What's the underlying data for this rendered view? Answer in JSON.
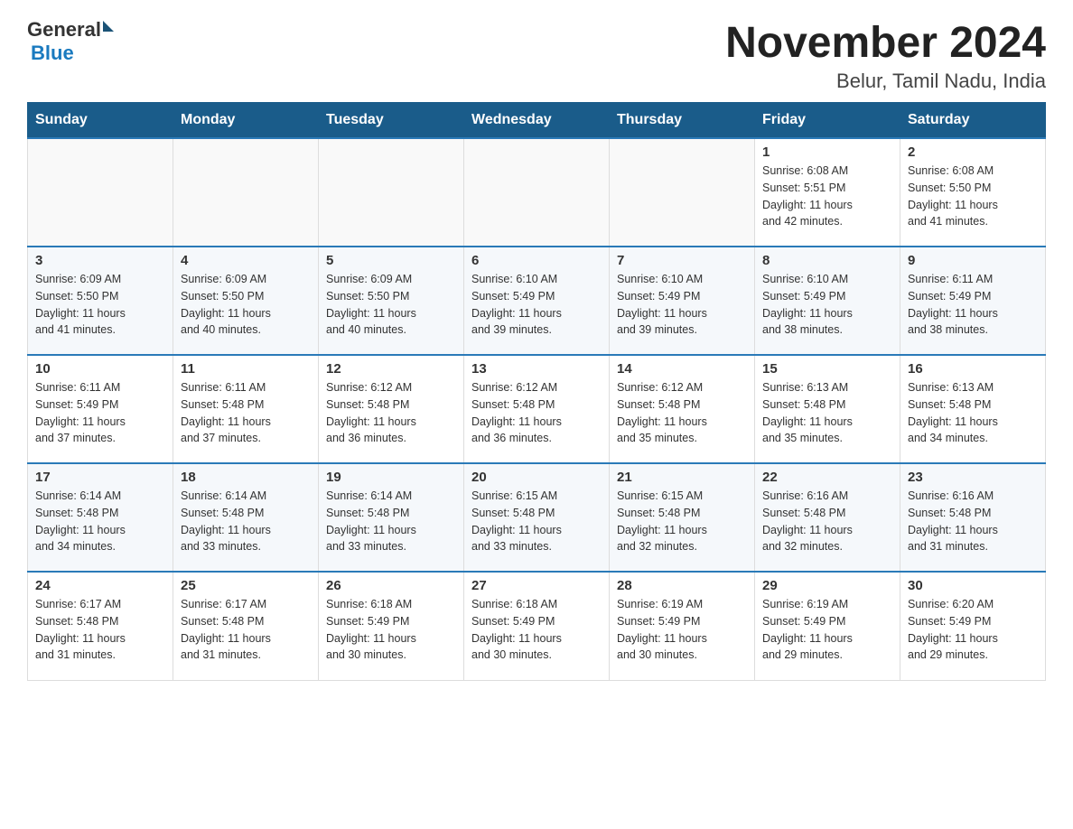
{
  "logo": {
    "text_general": "General",
    "triangle": "▶",
    "text_blue": "Blue"
  },
  "title": "November 2024",
  "subtitle": "Belur, Tamil Nadu, India",
  "days_of_week": [
    "Sunday",
    "Monday",
    "Tuesday",
    "Wednesday",
    "Thursday",
    "Friday",
    "Saturday"
  ],
  "weeks": [
    {
      "days": [
        {
          "number": "",
          "info": ""
        },
        {
          "number": "",
          "info": ""
        },
        {
          "number": "",
          "info": ""
        },
        {
          "number": "",
          "info": ""
        },
        {
          "number": "",
          "info": ""
        },
        {
          "number": "1",
          "info": "Sunrise: 6:08 AM\nSunset: 5:51 PM\nDaylight: 11 hours\nand 42 minutes."
        },
        {
          "number": "2",
          "info": "Sunrise: 6:08 AM\nSunset: 5:50 PM\nDaylight: 11 hours\nand 41 minutes."
        }
      ]
    },
    {
      "days": [
        {
          "number": "3",
          "info": "Sunrise: 6:09 AM\nSunset: 5:50 PM\nDaylight: 11 hours\nand 41 minutes."
        },
        {
          "number": "4",
          "info": "Sunrise: 6:09 AM\nSunset: 5:50 PM\nDaylight: 11 hours\nand 40 minutes."
        },
        {
          "number": "5",
          "info": "Sunrise: 6:09 AM\nSunset: 5:50 PM\nDaylight: 11 hours\nand 40 minutes."
        },
        {
          "number": "6",
          "info": "Sunrise: 6:10 AM\nSunset: 5:49 PM\nDaylight: 11 hours\nand 39 minutes."
        },
        {
          "number": "7",
          "info": "Sunrise: 6:10 AM\nSunset: 5:49 PM\nDaylight: 11 hours\nand 39 minutes."
        },
        {
          "number": "8",
          "info": "Sunrise: 6:10 AM\nSunset: 5:49 PM\nDaylight: 11 hours\nand 38 minutes."
        },
        {
          "number": "9",
          "info": "Sunrise: 6:11 AM\nSunset: 5:49 PM\nDaylight: 11 hours\nand 38 minutes."
        }
      ]
    },
    {
      "days": [
        {
          "number": "10",
          "info": "Sunrise: 6:11 AM\nSunset: 5:49 PM\nDaylight: 11 hours\nand 37 minutes."
        },
        {
          "number": "11",
          "info": "Sunrise: 6:11 AM\nSunset: 5:48 PM\nDaylight: 11 hours\nand 37 minutes."
        },
        {
          "number": "12",
          "info": "Sunrise: 6:12 AM\nSunset: 5:48 PM\nDaylight: 11 hours\nand 36 minutes."
        },
        {
          "number": "13",
          "info": "Sunrise: 6:12 AM\nSunset: 5:48 PM\nDaylight: 11 hours\nand 36 minutes."
        },
        {
          "number": "14",
          "info": "Sunrise: 6:12 AM\nSunset: 5:48 PM\nDaylight: 11 hours\nand 35 minutes."
        },
        {
          "number": "15",
          "info": "Sunrise: 6:13 AM\nSunset: 5:48 PM\nDaylight: 11 hours\nand 35 minutes."
        },
        {
          "number": "16",
          "info": "Sunrise: 6:13 AM\nSunset: 5:48 PM\nDaylight: 11 hours\nand 34 minutes."
        }
      ]
    },
    {
      "days": [
        {
          "number": "17",
          "info": "Sunrise: 6:14 AM\nSunset: 5:48 PM\nDaylight: 11 hours\nand 34 minutes."
        },
        {
          "number": "18",
          "info": "Sunrise: 6:14 AM\nSunset: 5:48 PM\nDaylight: 11 hours\nand 33 minutes."
        },
        {
          "number": "19",
          "info": "Sunrise: 6:14 AM\nSunset: 5:48 PM\nDaylight: 11 hours\nand 33 minutes."
        },
        {
          "number": "20",
          "info": "Sunrise: 6:15 AM\nSunset: 5:48 PM\nDaylight: 11 hours\nand 33 minutes."
        },
        {
          "number": "21",
          "info": "Sunrise: 6:15 AM\nSunset: 5:48 PM\nDaylight: 11 hours\nand 32 minutes."
        },
        {
          "number": "22",
          "info": "Sunrise: 6:16 AM\nSunset: 5:48 PM\nDaylight: 11 hours\nand 32 minutes."
        },
        {
          "number": "23",
          "info": "Sunrise: 6:16 AM\nSunset: 5:48 PM\nDaylight: 11 hours\nand 31 minutes."
        }
      ]
    },
    {
      "days": [
        {
          "number": "24",
          "info": "Sunrise: 6:17 AM\nSunset: 5:48 PM\nDaylight: 11 hours\nand 31 minutes."
        },
        {
          "number": "25",
          "info": "Sunrise: 6:17 AM\nSunset: 5:48 PM\nDaylight: 11 hours\nand 31 minutes."
        },
        {
          "number": "26",
          "info": "Sunrise: 6:18 AM\nSunset: 5:49 PM\nDaylight: 11 hours\nand 30 minutes."
        },
        {
          "number": "27",
          "info": "Sunrise: 6:18 AM\nSunset: 5:49 PM\nDaylight: 11 hours\nand 30 minutes."
        },
        {
          "number": "28",
          "info": "Sunrise: 6:19 AM\nSunset: 5:49 PM\nDaylight: 11 hours\nand 30 minutes."
        },
        {
          "number": "29",
          "info": "Sunrise: 6:19 AM\nSunset: 5:49 PM\nDaylight: 11 hours\nand 29 minutes."
        },
        {
          "number": "30",
          "info": "Sunrise: 6:20 AM\nSunset: 5:49 PM\nDaylight: 11 hours\nand 29 minutes."
        }
      ]
    }
  ]
}
